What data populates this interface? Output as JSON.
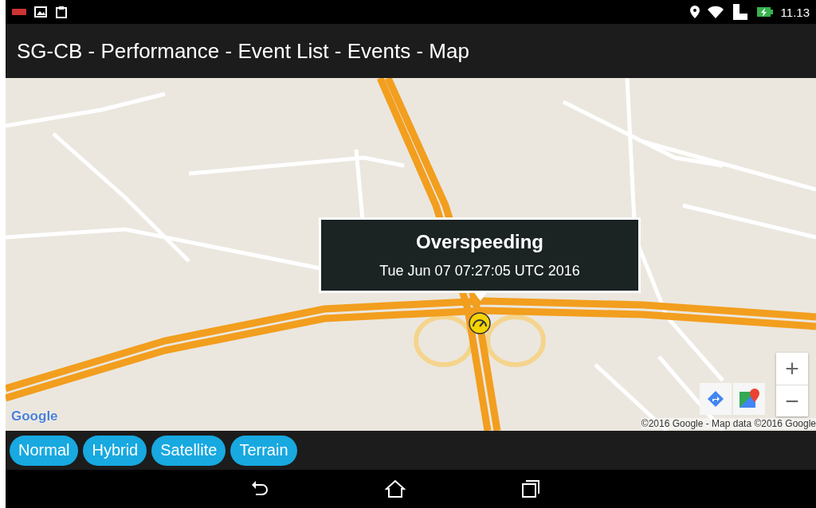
{
  "status_bar": {
    "time": "11.13"
  },
  "title": "SG-CB - Performance - Event List - Events - Map",
  "map": {
    "info_window": {
      "title": "Overspeeding",
      "subtitle": "Tue Jun 07 07:27:05 UTC 2016"
    },
    "zoom_in": "+",
    "zoom_out": "−",
    "logo": "Google",
    "attribution": "©2016 Google - Map data ©2016 Google"
  },
  "map_types": [
    {
      "label": "Normal"
    },
    {
      "label": "Hybrid"
    },
    {
      "label": "Satellite"
    },
    {
      "label": "Terrain"
    }
  ]
}
